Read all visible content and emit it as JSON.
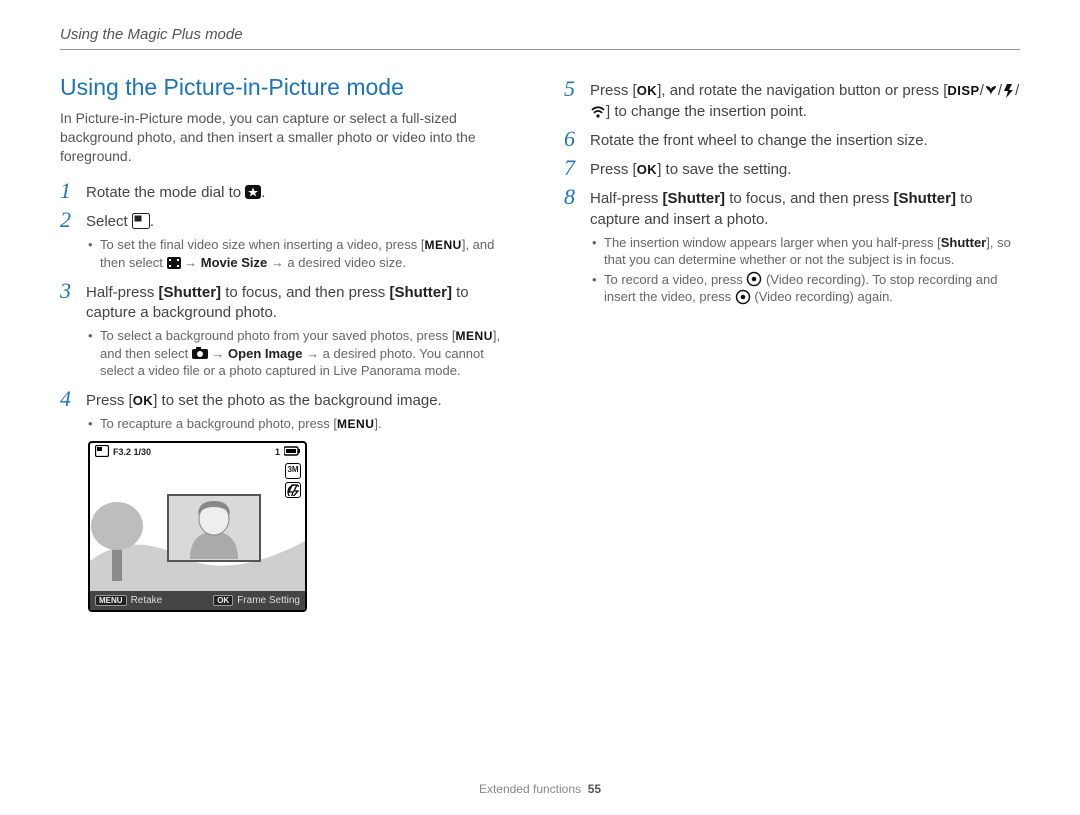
{
  "header": {
    "section_label": "Using the Magic Plus mode"
  },
  "left": {
    "heading": "Using the Picture-in-Picture mode",
    "intro": "In Picture-in-Picture mode, you can capture or select a full-sized background photo, and then insert a smaller photo or video into the foreground.",
    "steps": [
      {
        "num": "1",
        "text_pre": "Rotate the mode dial to ",
        "icon": "star-dial-icon",
        "text_post": "."
      },
      {
        "num": "2",
        "text_pre": "Select ",
        "icon": "pip-mode-icon",
        "text_post": ".",
        "bullets": [
          {
            "pre": "To set the final video size when inserting a video, press [",
            "btn": "MENU",
            "mid": "], and then select ",
            "icon": "movie-icon",
            "arrow": " → ",
            "bold": "Movie Size",
            "post": " → a desired video size."
          }
        ]
      },
      {
        "num": "3",
        "parts": [
          {
            "t": "Half-press "
          },
          {
            "b": "[Shutter]"
          },
          {
            "t": " to focus, and then press "
          },
          {
            "b": "[Shutter]"
          },
          {
            "t": " to capture a background photo."
          }
        ],
        "bullets": [
          {
            "pre": "To select a background photo from your saved photos, press [",
            "btn": "MENU",
            "mid": "], and then select ",
            "icon": "camera-icon",
            "arrow": " → ",
            "bold": "Open Image",
            "post": " → a desired photo. You cannot select a video file or a photo captured in Live Panorama mode."
          }
        ]
      },
      {
        "num": "4",
        "parts": [
          {
            "t": "Press ["
          },
          {
            "btn": "OK"
          },
          {
            "t": "] to set the photo as the background image."
          }
        ],
        "bullets": [
          {
            "pre": "To recapture a background photo, press [",
            "btn": "MENU",
            "post": "]."
          }
        ]
      }
    ],
    "lcd": {
      "top_left_info": "F3.2 1/30",
      "top_right_count": "1",
      "side1": "3M",
      "side2": "flash-off",
      "bottom_left_btn": "MENU",
      "bottom_left_label": "Retake",
      "bottom_right_btn": "OK",
      "bottom_right_label": "Frame Setting"
    }
  },
  "right": {
    "steps": [
      {
        "num": "5",
        "parts": [
          {
            "t": "Press ["
          },
          {
            "btn": "OK"
          },
          {
            "t": "], and rotate the navigation button or press ["
          },
          {
            "btn": "DISP"
          },
          {
            "t": "/"
          },
          {
            "icon": "macro-icon"
          },
          {
            "t": "/"
          },
          {
            "icon": "flash-icon"
          },
          {
            "t": "/"
          },
          {
            "icon": "wifi-icon"
          },
          {
            "t": "] to change the insertion point."
          }
        ]
      },
      {
        "num": "6",
        "text": "Rotate the front wheel to change the insertion size."
      },
      {
        "num": "7",
        "parts": [
          {
            "t": "Press ["
          },
          {
            "btn": "OK"
          },
          {
            "t": "] to save the setting."
          }
        ]
      },
      {
        "num": "8",
        "parts": [
          {
            "t": "Half-press "
          },
          {
            "b": "[Shutter]"
          },
          {
            "t": " to focus, and then press "
          },
          {
            "b": "[Shutter]"
          },
          {
            "t": " to capture and insert a photo."
          }
        ],
        "bullets": [
          {
            "pre": "The insertion window appears larger when you half-press [",
            "bold": "Shutter",
            "post": "], so that you can determine whether or not the subject is in focus."
          },
          {
            "pre": "To record a video, press ",
            "icon": "rec-icon",
            "mid": " (Video recording). To stop recording and insert the video, press ",
            "icon2": "rec-icon",
            "post": " (Video recording) again."
          }
        ]
      }
    ]
  },
  "footer": {
    "label": "Extended functions",
    "page": "55"
  },
  "icons": {
    "star-dial-icon": "star",
    "pip-mode-icon": "pip",
    "movie-icon": "movie",
    "camera-icon": "camera",
    "macro-icon": "macro",
    "flash-icon": "flash",
    "wifi-icon": "wifi",
    "rec-icon": "rec"
  }
}
